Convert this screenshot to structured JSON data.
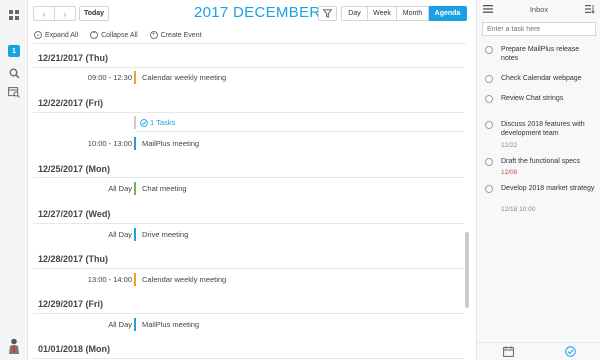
{
  "rail": {
    "badge": "1"
  },
  "toolbar": {
    "today_label": "Today",
    "month_title": "2017 DECEMBER",
    "views": [
      "Day",
      "Week",
      "Month",
      "Agenda"
    ],
    "active_view": "Agenda"
  },
  "actions": {
    "expand_all": "Expand All",
    "collapse_all": "Collapse All",
    "create_event": "Create Event"
  },
  "agenda": {
    "days": [
      {
        "date": "12/21/2017 (Thu)",
        "events": [
          {
            "time": "09:00 - 12:30",
            "title": "Calendar weekly meeting",
            "color": "#f0a030"
          }
        ]
      },
      {
        "date": "12/22/2017 (Fri)",
        "tasks_label": "1 Tasks",
        "events": [
          {
            "time": "10:00 - 13:00",
            "title": "MailPlus meeting",
            "color": "#1ba1e2"
          }
        ]
      },
      {
        "date": "12/25/2017 (Mon)",
        "events": [
          {
            "time": "All Day",
            "title": "Chat meeting",
            "color": "#7cb342"
          }
        ]
      },
      {
        "date": "12/27/2017 (Wed)",
        "events": [
          {
            "time": "All Day",
            "title": "Drive meeting",
            "color": "#1ba1e2"
          }
        ]
      },
      {
        "date": "12/28/2017 (Thu)",
        "events": [
          {
            "time": "13:00 - 14:00",
            "title": "Calendar weekly meeting",
            "color": "#f0a030"
          }
        ]
      },
      {
        "date": "12/29/2017 (Fri)",
        "events": [
          {
            "time": "All Day",
            "title": "MailPlus meeting",
            "color": "#1ba1e2"
          }
        ]
      },
      {
        "date": "01/01/2018 (Mon)",
        "events": []
      }
    ]
  },
  "inbox": {
    "title": "Inbox",
    "placeholder": "Enter a task here",
    "tasks": [
      {
        "title": "Prepare MailPlus release notes",
        "meta": ""
      },
      {
        "title": "Check Calendar webpage",
        "meta": ""
      },
      {
        "title": "Review Chat strings",
        "meta": ""
      },
      {
        "title": "Discuss 2018 features with development team",
        "meta": "12/22"
      },
      {
        "title": "Draft the functional specs",
        "meta": "12/08",
        "overdue": true
      },
      {
        "title": "Develop 2018 market strategy",
        "meta": "12/18  10:00"
      }
    ]
  }
}
